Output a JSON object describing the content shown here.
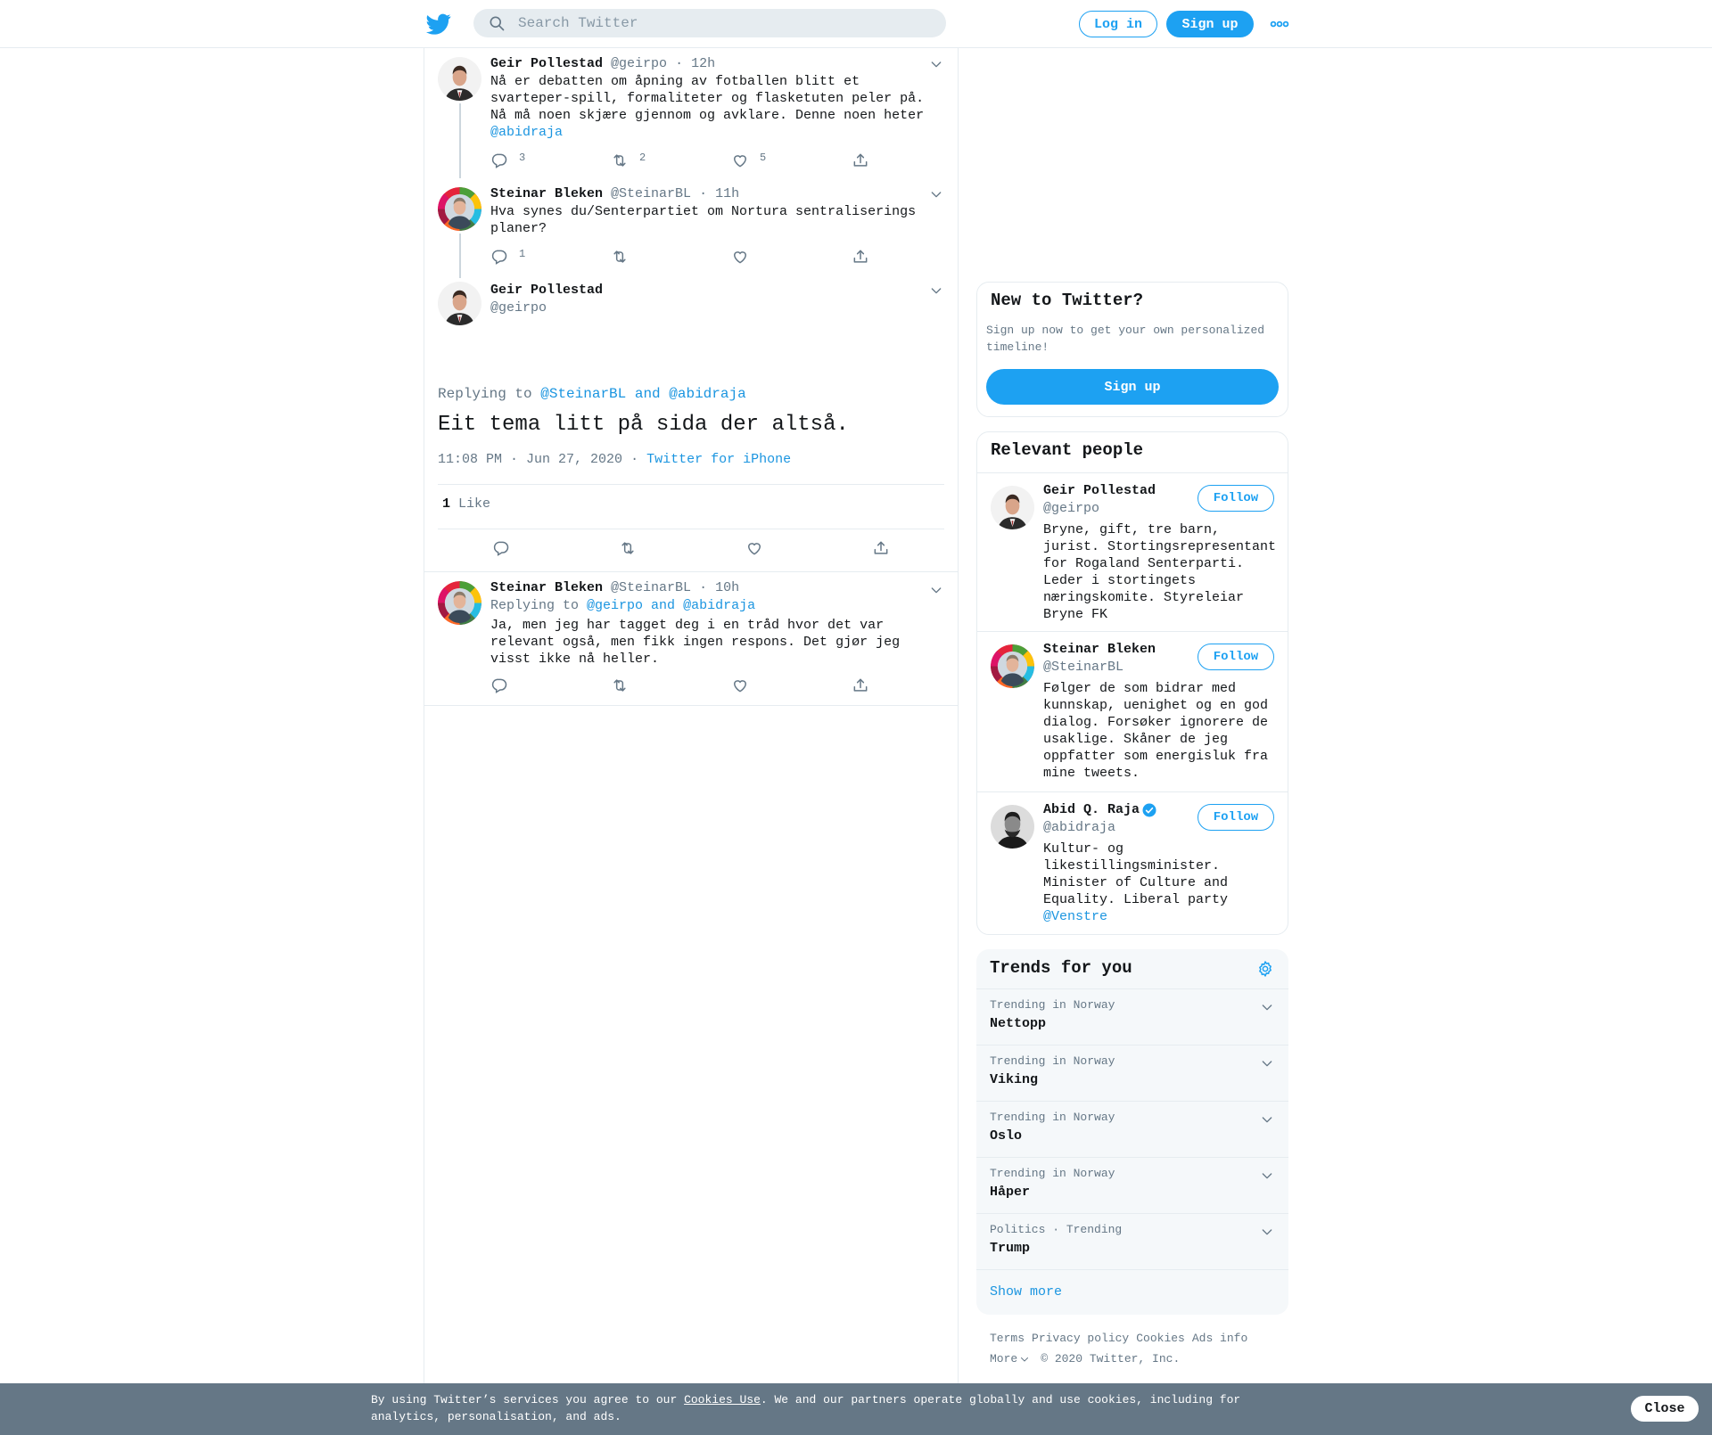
{
  "header": {
    "search_placeholder": "Search Twitter",
    "login_label": "Log in",
    "signup_label": "Sign up"
  },
  "thread": [
    {
      "name": "Geir Pollestad",
      "handle": "@geirpo",
      "time": "· 12h",
      "text": "Nå er debatten om åpning av fotballen blitt et svarteper-spill, formaliteter og flasketuten peler på. Nå må noen skjære gjennom og avklare. Denne noen heter",
      "mention": "@abidraja",
      "replies": "3",
      "retweets": "2",
      "likes": "5"
    },
    {
      "name": "Steinar Bleken",
      "handle": "@SteinarBL",
      "time": "· 11h",
      "text": "Hva synes du/Senterpartiet om Nortura sentraliserings planer?",
      "replies": "1",
      "retweets": "",
      "likes": ""
    }
  ],
  "focus": {
    "name": "Geir Pollestad",
    "handle": "@geirpo",
    "replying_prefix": "Replying to",
    "replying_to": "@SteinarBL and @abidraja",
    "text": "Eit tema litt på sida der altså.",
    "timestamp": "11:08 PM · Jun 27, 2020",
    "source_sep": "·",
    "source": "Twitter for iPhone",
    "like_count": "1",
    "like_label": "Like"
  },
  "reply": {
    "name": "Steinar Bleken",
    "handle": "@SteinarBL",
    "time": "· 10h",
    "replying_prefix": "Replying to",
    "replying_to": "@geirpo and @abidraja",
    "text": "Ja, men jeg har tagget deg i en tråd hvor det var relevant også, men fikk ingen respons. Det gjør jeg visst ikke nå heller."
  },
  "new_to_twitter": {
    "title": "New to Twitter?",
    "subtitle": "Sign up now to get your own personalized timeline!",
    "signup_label": "Sign up"
  },
  "relevant_people": {
    "title": "Relevant people",
    "follow_label": "Follow",
    "people": [
      {
        "name": "Geir Pollestad",
        "handle": "@geirpo",
        "bio": "Bryne, gift, tre barn, jurist. Stortingsrepresentant for Rogaland Senterparti. Leder i stortingets næringskomite. Styreleiar Bryne FK"
      },
      {
        "name": "Steinar Bleken",
        "handle": "@SteinarBL",
        "bio": "Følger de som bidrar med kunnskap, uenighet og en god dialog. Forsøker ignorere de usaklige. Skåner de jeg oppfatter som energisluk fra mine tweets."
      },
      {
        "name": "Abid Q. Raja",
        "handle": "@abidraja",
        "bio": "Kultur- og likestillingsminister. Minister of Culture and Equality. Liberal party",
        "bio_link": "@Venstre"
      }
    ]
  },
  "trends": {
    "title": "Trends for you",
    "items": [
      {
        "meta": "Trending in Norway",
        "name": "Nettopp"
      },
      {
        "meta": "Trending in Norway",
        "name": "Viking"
      },
      {
        "meta": "Trending in Norway",
        "name": "Oslo"
      },
      {
        "meta": "Trending in Norway",
        "name": "Håper"
      },
      {
        "meta": "Politics · Trending",
        "name": "Trump"
      }
    ],
    "show_more": "Show more"
  },
  "footer": {
    "terms": "Terms",
    "privacy": "Privacy policy",
    "cookies": "Cookies",
    "ads": "Ads info",
    "more": "More",
    "copyright": "© 2020 Twitter, Inc."
  },
  "cookie_bar": {
    "text_before": "By using Twitter’s services you agree to our",
    "link": "Cookies Use",
    "text_after": ". We and our partners operate globally and use cookies, including for analytics, personalisation, and ads.",
    "close_label": "Close"
  },
  "colors": {
    "accent": "#1da1f2",
    "link": "#1b95e0",
    "muted": "#657786",
    "border": "#e6ecf0",
    "cookie_bg": "#657786"
  }
}
